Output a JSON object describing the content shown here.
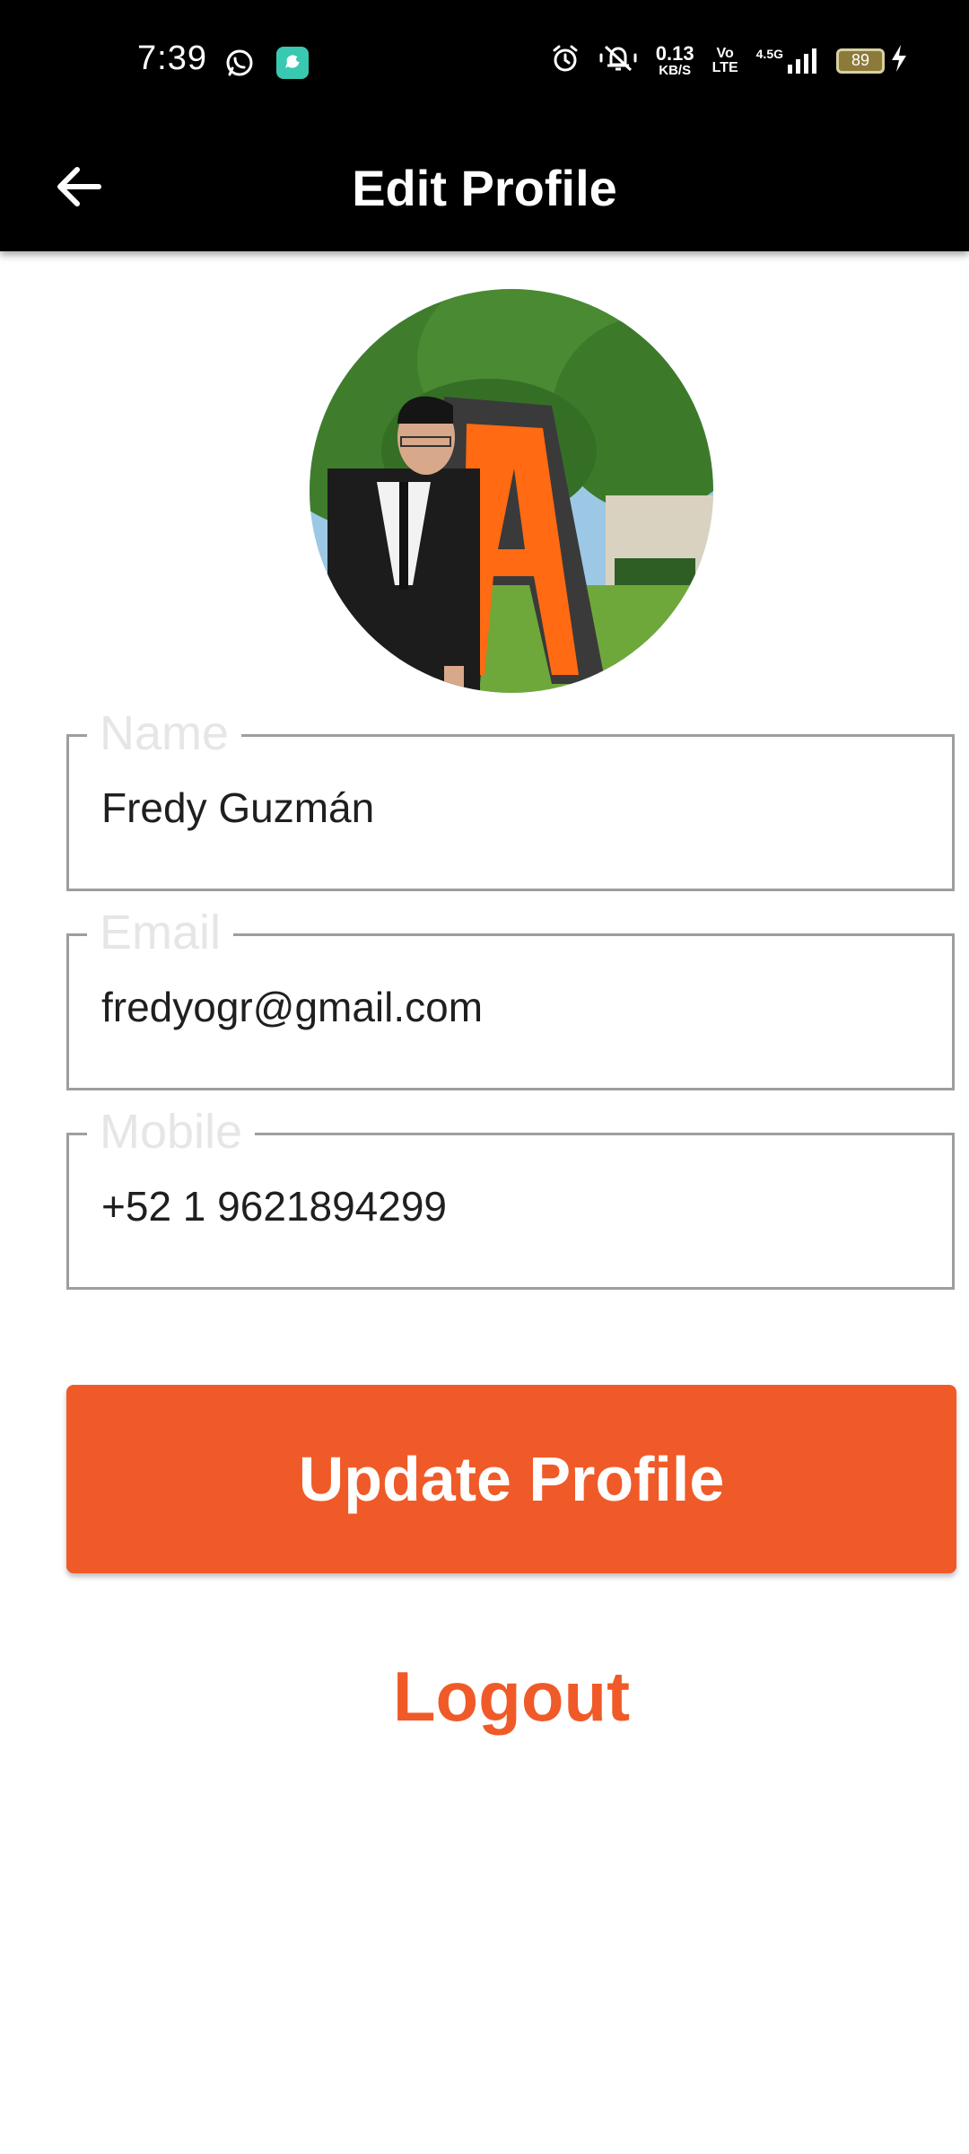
{
  "status_bar": {
    "time": "7:39",
    "net_speed_value": "0.13",
    "net_speed_unit": "KB/S",
    "volte_top": "Vo",
    "volte_bottom": "LTE",
    "network_type": "4.5G",
    "battery_level": "89"
  },
  "app_bar": {
    "title": "Edit Profile"
  },
  "form": {
    "name": {
      "label": "Name",
      "value": "Fredy Guzmán"
    },
    "email": {
      "label": "Email",
      "value": "fredyogr@gmail.com"
    },
    "mobile": {
      "label": "Mobile",
      "value": "+52 1 9621894299"
    }
  },
  "actions": {
    "update_label": "Update Profile",
    "logout_label": "Logout"
  },
  "colors": {
    "accent": "#f05a28",
    "app_bar": "#000000",
    "field_border": "#9e9e9e",
    "label_text": "#e6e6e6"
  },
  "icons": {
    "back": "arrow-left-icon",
    "whatsapp": "whatsapp-icon",
    "chat_app": "chat-bubble-icon",
    "alarm": "alarm-icon",
    "mute": "bell-off-icon",
    "signal": "signal-bars-icon",
    "charging": "lightning-icon"
  }
}
